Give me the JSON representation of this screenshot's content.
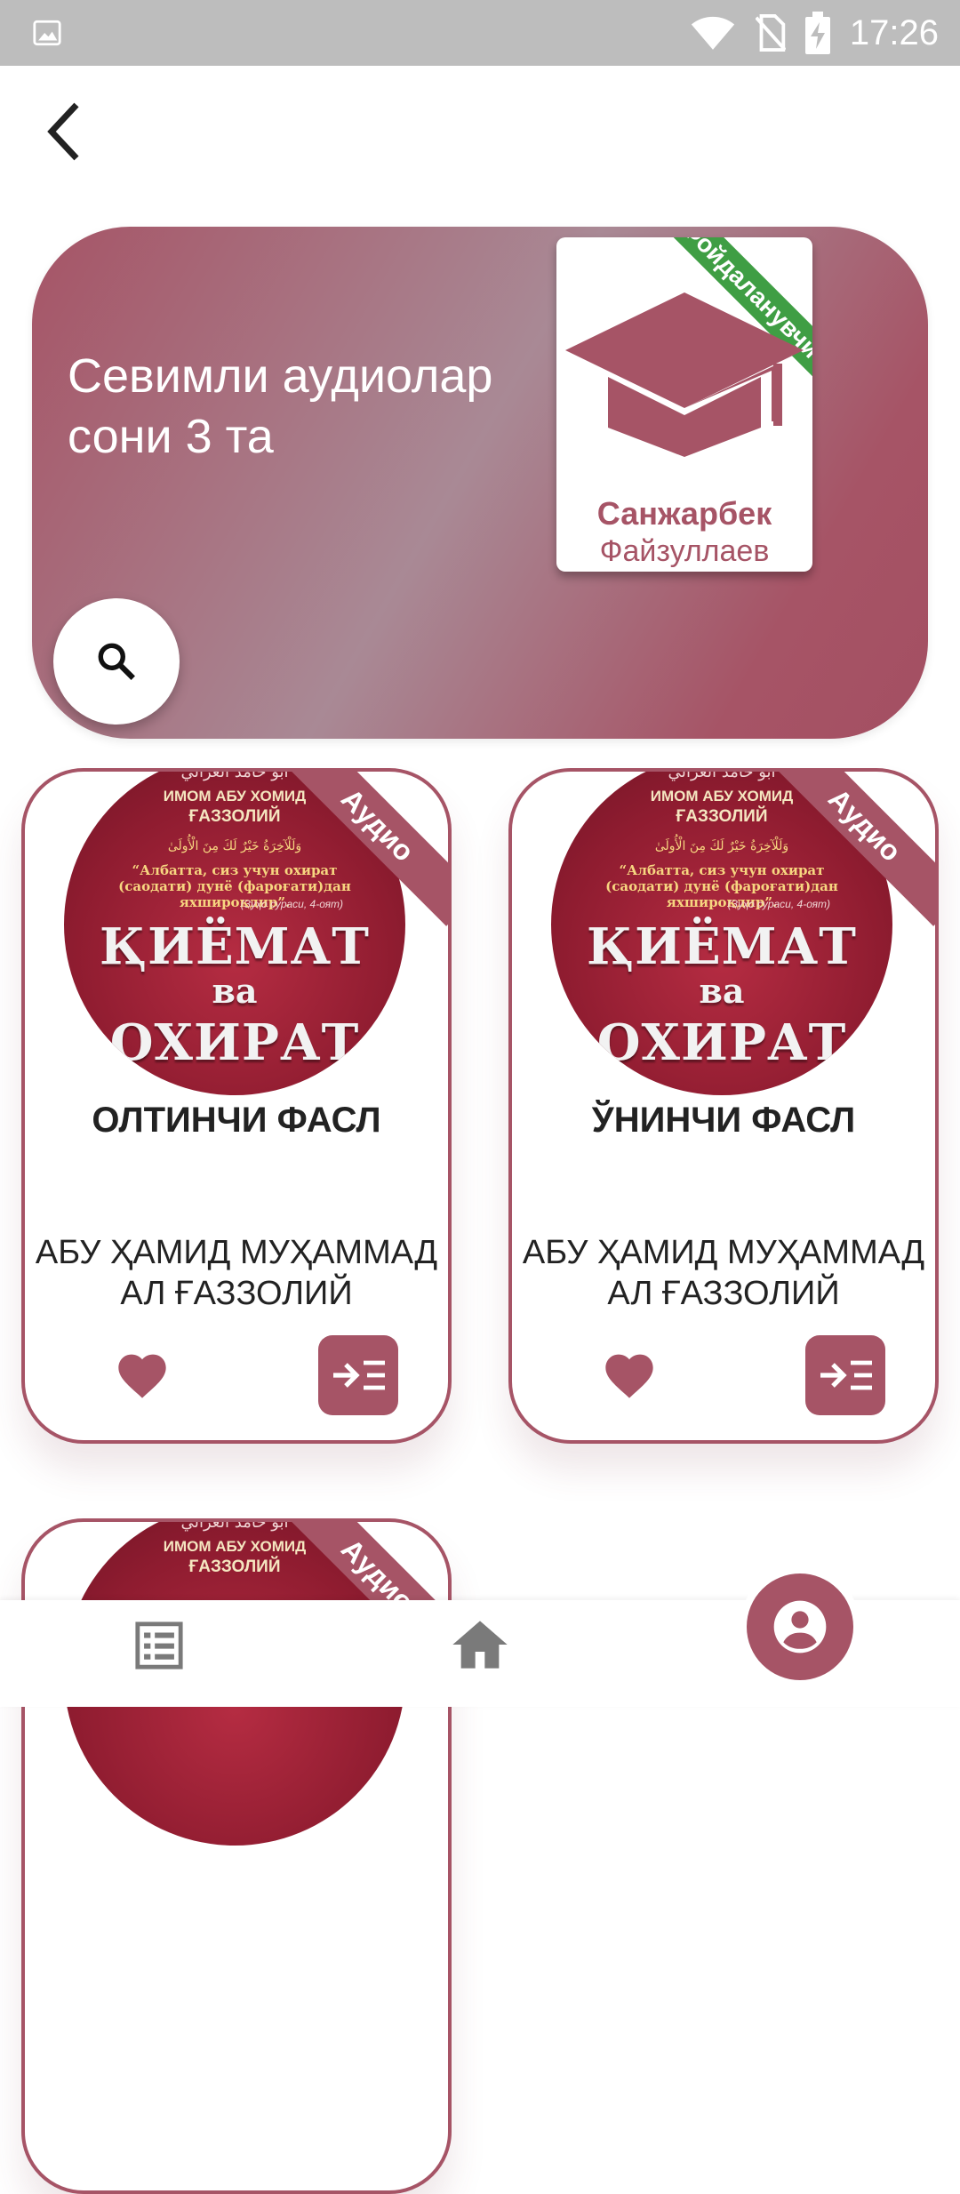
{
  "status_bar": {
    "time": "17:26"
  },
  "hero": {
    "text": "Севимли аудиолар сони 3 та",
    "profile": {
      "ribbon": "Фойдаланувчи",
      "first_name": "Санжарбек",
      "last_name": "Файзуллаев"
    }
  },
  "cover_text": {
    "arabic_top": "أبو حامد الغزالي",
    "imom": "ИМОМ АБУ ХОМИД",
    "gazzoliy": "ҒАЗЗОЛИЙ",
    "ayah": "وَلَلْآخِرَةُ خَيْرٌ لَكَ مِنَ الْأُولَىٰ",
    "quote": "“Албатта, сиз учун охират (саодати) дунё (фароғати)дан яхшироқдир”.",
    "ref": "(Зуҳо сураси, 4-оят)",
    "title1": "ҚИЁМАТ",
    "title2": "ва",
    "title3": "ОХИРАТ"
  },
  "cards": [
    {
      "badge": "Аудио",
      "title": "ОЛТИНЧИ ФАСЛ",
      "author": "АБУ ҲАМИД МУҲАММАД АЛ ҒАЗЗОЛИЙ"
    },
    {
      "badge": "Аудио",
      "title": "ЎНИНЧИ ФАСЛ",
      "author": "АБУ ҲАМИД МУҲАММАД АЛ ҒАЗЗОЛИЙ"
    },
    {
      "badge": "Аудио"
    }
  ],
  "colors": {
    "accent": "#a65466",
    "ribbon_green": "#3f9e44",
    "status_bar": "#bdbdbd"
  },
  "icons": [
    "image-icon",
    "wifi-icon",
    "no-sim-icon",
    "battery-charging-icon",
    "back-arrow-icon",
    "search-icon",
    "graduation-cap-icon",
    "heart-icon",
    "playlist-add-icon",
    "list-icon",
    "home-icon",
    "account-circle-icon"
  ]
}
